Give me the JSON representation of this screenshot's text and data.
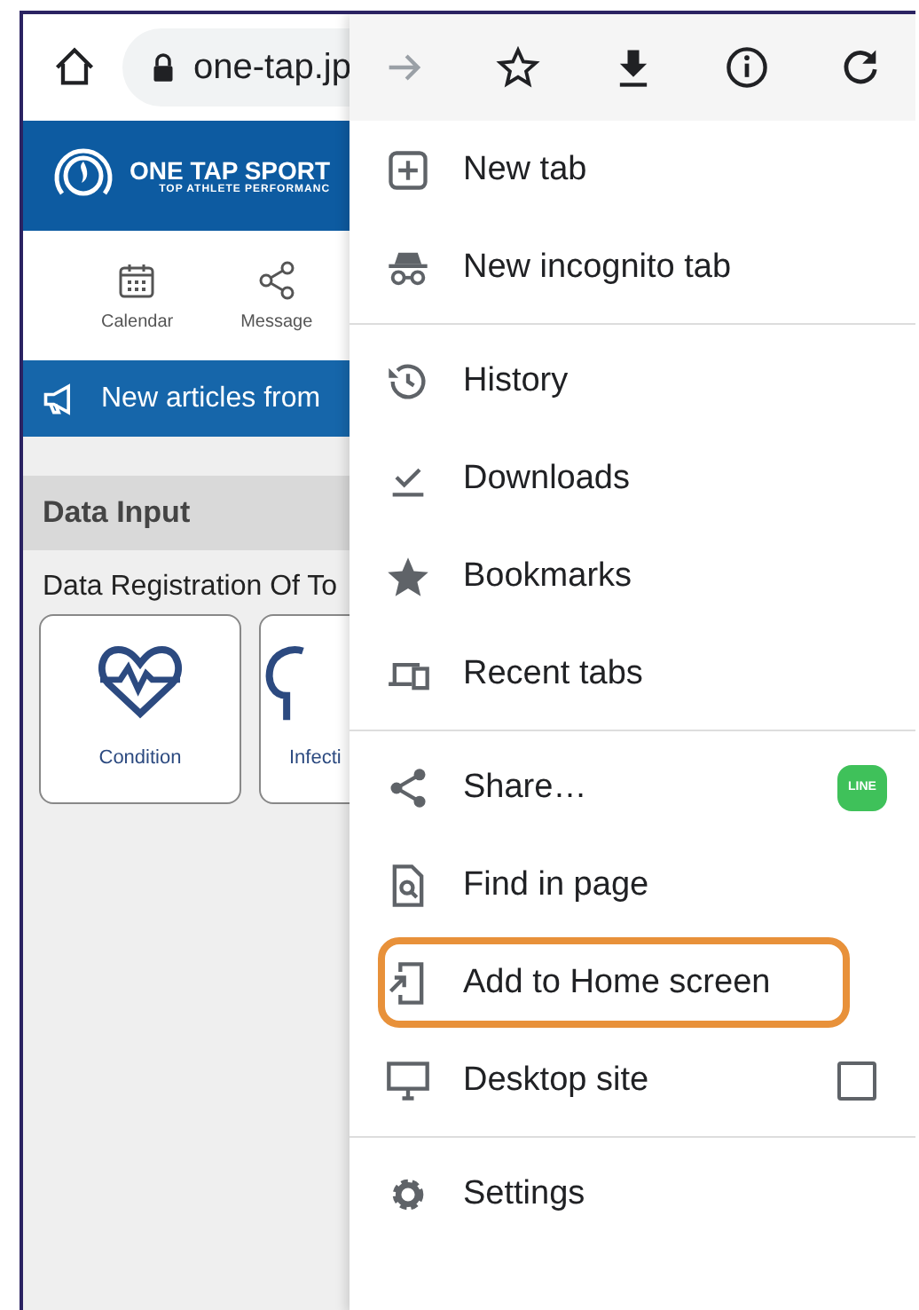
{
  "address_bar": {
    "url": "one-tap.jp"
  },
  "page": {
    "logo_title": "ONE TAP SPORT",
    "logo_tagline": "TOP ATHLETE PERFORMANC",
    "nav": [
      {
        "label": "Calendar"
      },
      {
        "label": "Message"
      }
    ],
    "banner": "New articles from",
    "section_title": "Data Input",
    "subtitle": "Data Registration Of To",
    "cards": [
      {
        "label": "Condition"
      },
      {
        "label": "Infecti"
      }
    ]
  },
  "menu": {
    "groups": [
      [
        {
          "label": "New tab",
          "kind": "plain",
          "highlighted": false
        },
        {
          "label": "New incognito tab",
          "kind": "plain",
          "highlighted": false
        }
      ],
      [
        {
          "label": "History",
          "kind": "plain",
          "highlighted": false
        },
        {
          "label": "Downloads",
          "kind": "plain",
          "highlighted": false
        },
        {
          "label": "Bookmarks",
          "kind": "plain",
          "highlighted": false
        },
        {
          "label": "Recent tabs",
          "kind": "plain",
          "highlighted": false
        }
      ],
      [
        {
          "label": "Share…",
          "kind": "share",
          "app_label": "LINE",
          "highlighted": false
        },
        {
          "label": "Find in page",
          "kind": "plain",
          "highlighted": false
        },
        {
          "label": "Add to Home screen",
          "kind": "plain",
          "highlighted": true
        },
        {
          "label": "Desktop site",
          "kind": "checkbox",
          "checked": false,
          "highlighted": false
        }
      ],
      [
        {
          "label": "Settings",
          "kind": "plain",
          "highlighted": false
        }
      ]
    ]
  }
}
